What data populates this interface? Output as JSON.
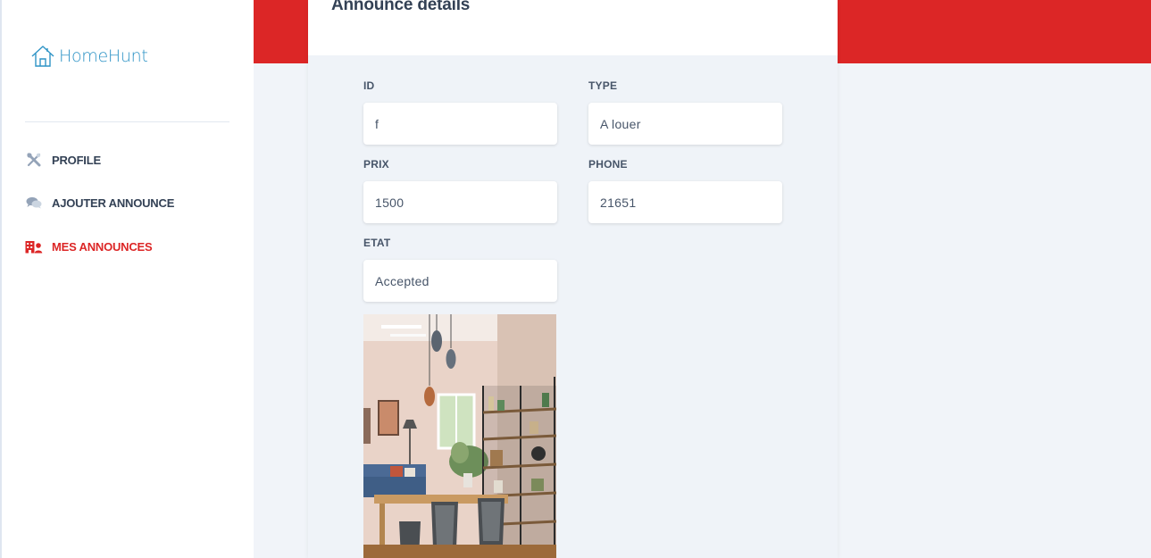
{
  "brand": {
    "name": "HomeHunt",
    "color": "#2f94c6"
  },
  "accent_color": "#dc2626",
  "nav": {
    "items": [
      {
        "label": "PROFILE",
        "icon": "tools-icon",
        "active": false
      },
      {
        "label": "AJOUTER ANNOUNCE",
        "icon": "comments-icon",
        "active": false
      },
      {
        "label": "MES ANNOUNCES",
        "icon": "building-user-icon",
        "active": true
      }
    ]
  },
  "card": {
    "title": "Announce details",
    "fields": {
      "id": {
        "label": "ID",
        "value": "f"
      },
      "type": {
        "label": "TYPE",
        "value": "A louer"
      },
      "prix": {
        "label": "PRIX",
        "value": "1500"
      },
      "phone": {
        "label": "PHONE",
        "value": "21651"
      },
      "etat": {
        "label": "ETAT",
        "value": "Accepted"
      }
    },
    "image": {
      "subject": "living-room-photo"
    }
  }
}
